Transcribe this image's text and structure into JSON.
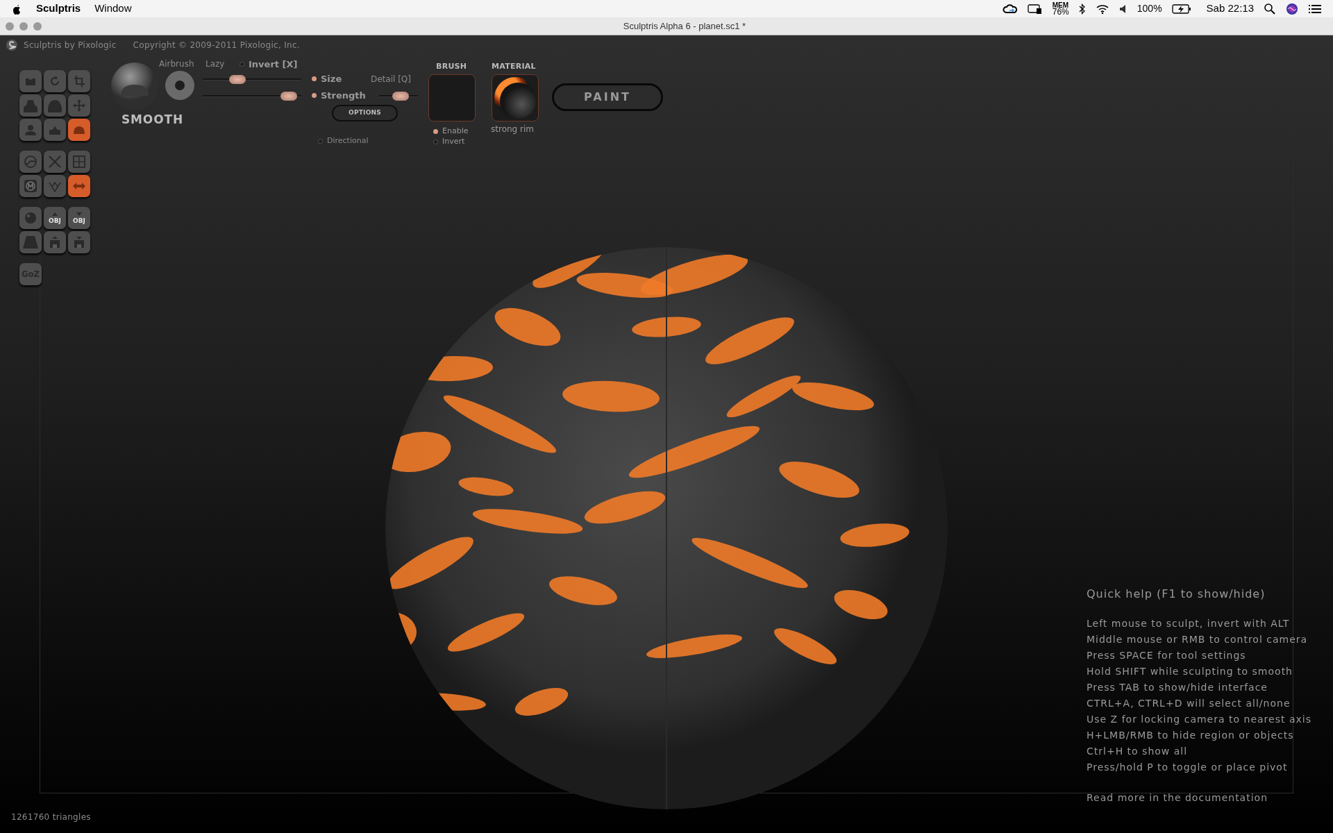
{
  "menu_bar": {
    "app": "Sculptris",
    "items": [
      "Window"
    ],
    "mem_label": "MEM",
    "mem_value": "76%",
    "battery": "100%",
    "clock": "Sab 22:13"
  },
  "window": {
    "title": "Sculptris Alpha 6 - planet.sc1 *"
  },
  "header": {
    "brand": "Sculptris by Pixologic",
    "copyright": "Copyright © 2009-2011 Pixologic, Inc."
  },
  "tool_groups": [
    [
      {
        "kind": "crease",
        "selected": false
      },
      {
        "kind": "rotate",
        "selected": false
      },
      {
        "kind": "scale",
        "selected": false
      },
      {
        "kind": "draw",
        "selected": false
      },
      {
        "kind": "inflate",
        "selected": false
      },
      {
        "kind": "grab",
        "selected": false
      },
      {
        "kind": "flatten",
        "selected": false
      },
      {
        "kind": "pinch",
        "selected": false
      },
      {
        "kind": "smooth",
        "selected": true
      }
    ],
    [
      {
        "kind": "reduce",
        "selected": false
      },
      {
        "kind": "mask",
        "selected": false
      },
      {
        "kind": "grid",
        "selected": false
      },
      {
        "kind": "mirror-m",
        "selected": false
      },
      {
        "kind": "wireframe",
        "selected": false
      },
      {
        "kind": "symmetry",
        "selected": true
      }
    ],
    [
      {
        "kind": "sphere",
        "selected": false
      },
      {
        "kind": "import",
        "selected": false,
        "label": "OBJ"
      },
      {
        "kind": "export",
        "selected": false,
        "label": "OBJ"
      },
      {
        "kind": "plane",
        "selected": false
      },
      {
        "kind": "open",
        "selected": false
      },
      {
        "kind": "save",
        "selected": false
      }
    ],
    [
      {
        "kind": "text",
        "selected": false,
        "label": "GoZ"
      }
    ]
  ],
  "brush_panel": {
    "tool_name": "SMOOTH",
    "airbrush": "Airbrush",
    "lazy": "Lazy",
    "invert": {
      "label": "Invert [X]",
      "on": false
    },
    "size": {
      "label": "Size",
      "on": true,
      "level": 0.35
    },
    "strength": {
      "label": "Strength",
      "on": true,
      "level": 0.87
    },
    "detail": {
      "label": "Detail [Q]",
      "level": 0.55
    },
    "options": "OPTIONS",
    "directional": {
      "label": "Directional",
      "on": false
    },
    "brush": {
      "title": "BRUSH",
      "enable": {
        "label": "Enable",
        "on": true
      },
      "invert": {
        "label": "Invert",
        "on": false
      }
    },
    "material": {
      "title": "MATERIAL",
      "name": "strong rim"
    },
    "mode_button": "PAINT"
  },
  "quick_help": {
    "title": "Quick help (F1 to show/hide)",
    "lines": [
      "Left mouse to sculpt, invert with ALT",
      "Middle mouse or RMB to control camera",
      "Press SPACE for tool settings",
      "Hold SHIFT while sculpting to smooth",
      "Press TAB to show/hide interface",
      "CTRL+A, CTRL+D will select all/none",
      "Use Z for locking camera to nearest axis",
      "H+LMB/RMB to hide region or objects",
      "Ctrl+H to show all",
      "Press/hold P to toggle or place pivot"
    ],
    "footer": "Read more in the documentation"
  },
  "status": {
    "triangles": "1261760 triangles"
  }
}
